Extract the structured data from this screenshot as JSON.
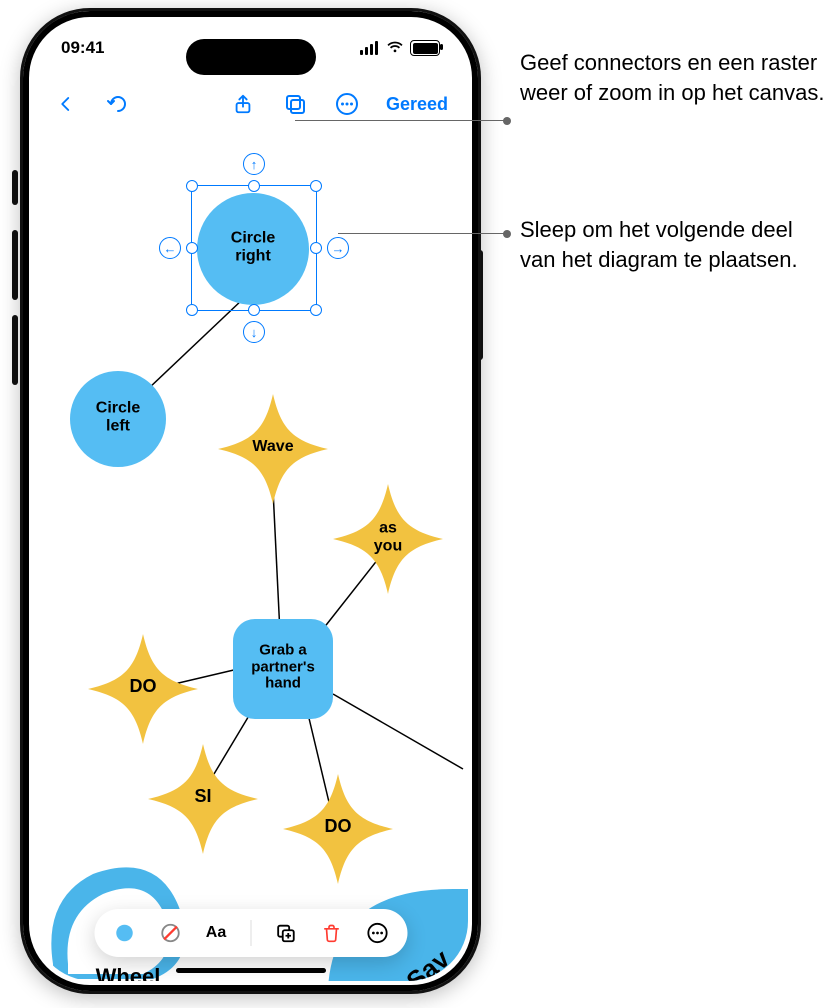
{
  "status": {
    "time": "09:41"
  },
  "toolbar": {
    "done": "Gereed"
  },
  "nodes": {
    "circle_right": "Circle right",
    "circle_left": "Circle left",
    "wave": "Wave",
    "as_you": "as you",
    "grab": "Grab a partner's hand",
    "do1": "DO",
    "si": "SI",
    "do2": "DO",
    "wheel": "Wheel",
    "sav": "Sav"
  },
  "callouts": {
    "canvas_controls": "Geef connectors en een raster weer of zoom in op het canvas.",
    "drag_handle": "Sleep om het volgende deel van het diagram te plaatsen."
  },
  "colors": {
    "blue": "#007AFF",
    "sky": "#55BDF3",
    "gold": "#F2C240",
    "black": "#000000",
    "red": "#FF3B30"
  }
}
